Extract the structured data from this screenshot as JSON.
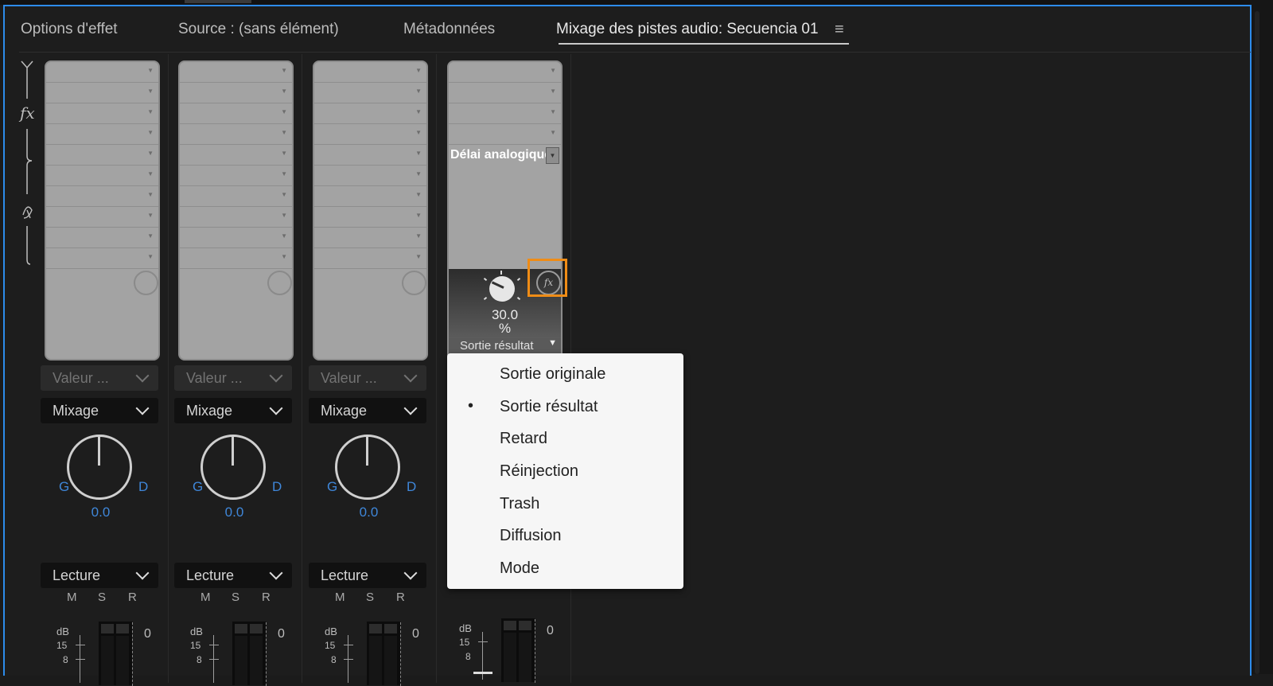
{
  "tabs": [
    {
      "label": "Options d'effet"
    },
    {
      "label": "Source : (sans élément)"
    },
    {
      "label": "Métadonnées"
    },
    {
      "label": "Mixage des pistes audio: Secuencia 01"
    }
  ],
  "tab_menu_icon": "hamburger-menu-icon",
  "left_rail": {
    "fx_label": "fx"
  },
  "strips": [
    {
      "value_dropdown": "Valeur ...",
      "mix_dropdown": "Mixage",
      "pan_left": "G",
      "pan_right": "D",
      "pan_value": "0.0",
      "mode_dropdown": "Lecture",
      "m": "M",
      "s": "S",
      "r": "R",
      "db_label": "dB",
      "db_15": "15",
      "db_8": "8",
      "meter_zero": "0"
    },
    {
      "value_dropdown": "Valeur ...",
      "mix_dropdown": "Mixage",
      "pan_left": "G",
      "pan_right": "D",
      "pan_value": "0.0",
      "mode_dropdown": "Lecture",
      "m": "M",
      "s": "S",
      "r": "R",
      "db_label": "dB",
      "db_15": "15",
      "db_8": "8",
      "meter_zero": "0"
    },
    {
      "value_dropdown": "Valeur ...",
      "mix_dropdown": "Mixage",
      "pan_left": "G",
      "pan_right": "D",
      "pan_value": "0.0",
      "mode_dropdown": "Lecture",
      "m": "M",
      "s": "S",
      "r": "R",
      "db_label": "dB",
      "db_15": "15",
      "db_8": "8",
      "meter_zero": "0"
    }
  ],
  "effect_strip": {
    "effect_name": "Délai analogique",
    "knob_value": "30.0",
    "knob_unit": "%",
    "param_selected": "Sortie résultat",
    "db_label": "dB",
    "db_15": "15",
    "db_8": "8",
    "meter_zero": "0"
  },
  "param_menu": {
    "selected_marker": "•",
    "items": [
      "Sortie originale",
      "Sortie résultat",
      "Retard",
      "Réinjection",
      "Trash",
      "Diffusion",
      "Mode"
    ]
  },
  "colors": {
    "accent_blue": "#3f87da",
    "highlight_orange": "#ef8c16",
    "focus_border": "#2d8ceb"
  }
}
